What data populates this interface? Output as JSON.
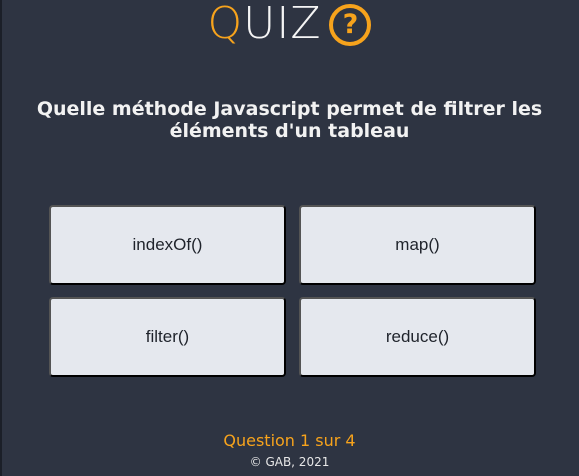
{
  "header": {
    "title_first_letter": "Q",
    "title_rest": "UIZ",
    "help_icon_glyph": "?"
  },
  "question": {
    "text": "Quelle méthode Javascript permet de filtrer les éléments d'un tableau"
  },
  "answers": [
    {
      "label": "indexOf()"
    },
    {
      "label": "map()"
    },
    {
      "label": "filter()"
    },
    {
      "label": "reduce()"
    }
  ],
  "progress": {
    "text": "Question 1 sur 4"
  },
  "footer": {
    "copyright": "© GAB, 2021"
  },
  "colors": {
    "background": "#2e3442",
    "accent": "#f7a31c",
    "answer_background": "#e5e8ee",
    "text": "#f2f2f2"
  },
  "icons": {
    "help": "help-circle-icon"
  }
}
